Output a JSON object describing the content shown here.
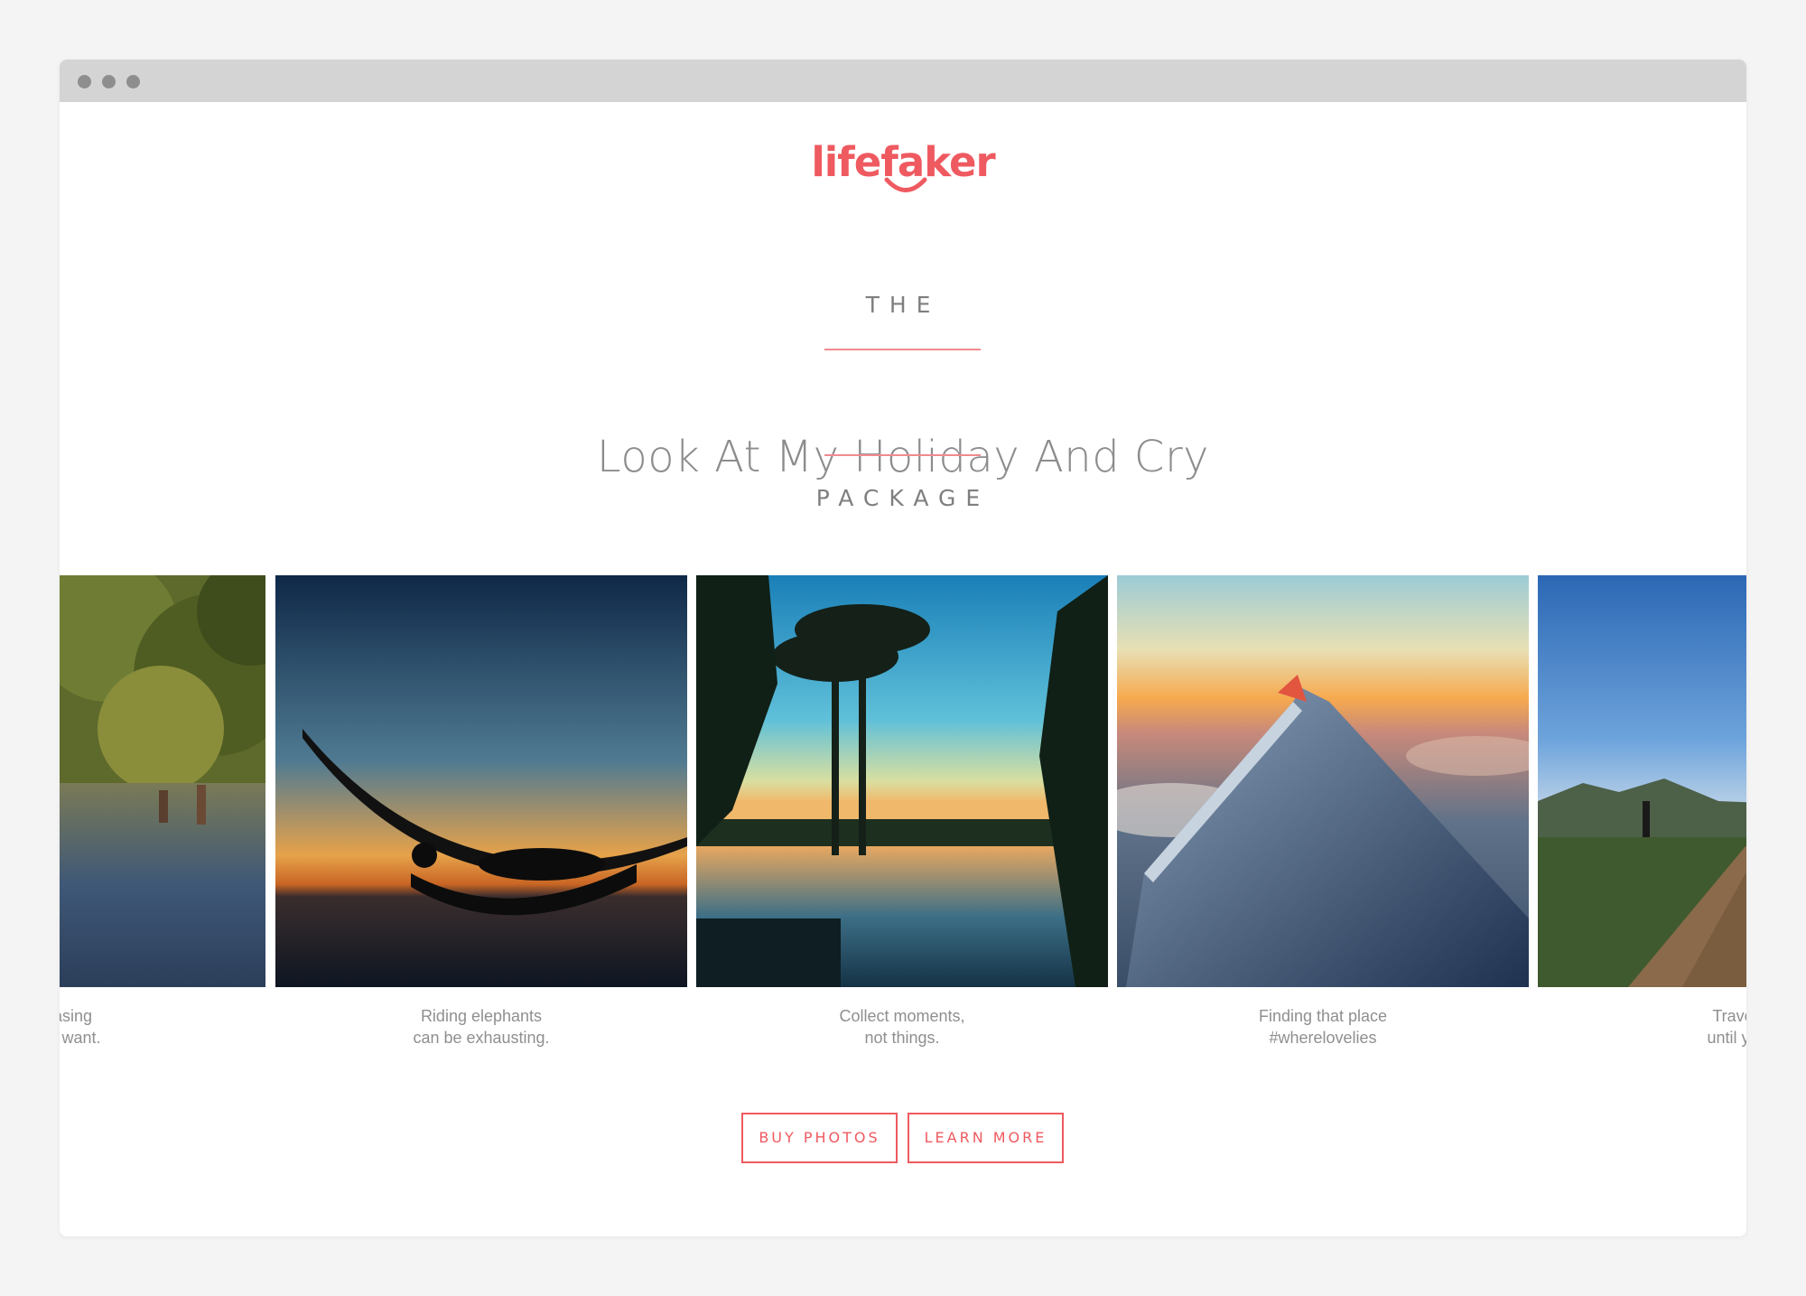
{
  "brand": {
    "name": "lifefaker",
    "accent_color": "#ee5a60"
  },
  "hero": {
    "kicker_top": "THE",
    "title": "Look At My Holiday And Cry",
    "kicker_bottom": "PACKAGE"
  },
  "photos": [
    {
      "caption_line1": "t chasing",
      "caption_line2": "ings I want.",
      "scene": "jungle-river"
    },
    {
      "caption_line1": "Riding elephants",
      "caption_line2": "can be exhausting.",
      "scene": "hammock-sunset"
    },
    {
      "caption_line1": "Collect moments,",
      "caption_line2": "not things.",
      "scene": "palm-pool"
    },
    {
      "caption_line1": "Finding that place",
      "caption_line2": "#wherelovelies",
      "scene": "airplane-wing"
    },
    {
      "caption_line1": "Travel fa",
      "caption_line2": "until you fi",
      "scene": "rock-fortress"
    }
  ],
  "buttons": {
    "buy": "BUY PHOTOS",
    "learn": "LEARN MORE"
  },
  "window_controls": [
    "dot",
    "dot",
    "dot"
  ]
}
